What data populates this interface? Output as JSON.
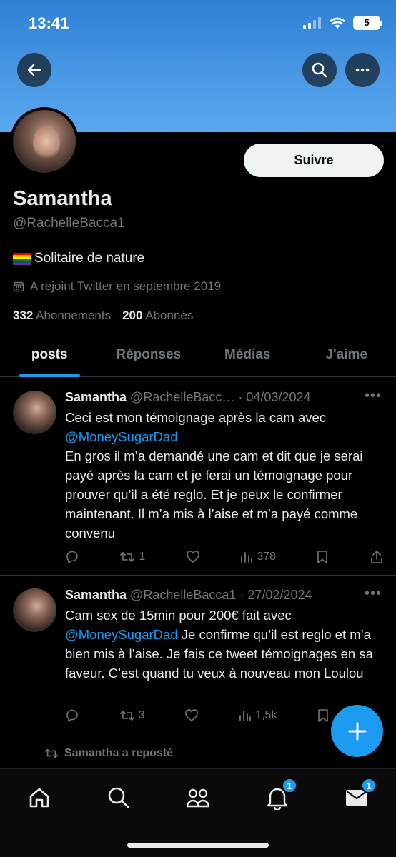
{
  "status": {
    "time": "13:41",
    "battery": "5"
  },
  "profile": {
    "name": "Samantha",
    "handle": "@RachelleBacca1",
    "bio": "Solitaire de nature",
    "joined": "A rejoint Twitter en septembre 2019",
    "following_count": "332",
    "following_label": "Abonnements",
    "followers_count": "200",
    "followers_label": "Abonnés",
    "follow_label": "Suivre"
  },
  "tabs": [
    "posts",
    "Réponses",
    "Médias",
    "J'aime"
  ],
  "tweets": [
    {
      "name": "Samantha",
      "handle": "@RachelleBacc…",
      "date": "· 04/03/2024",
      "line1": "Ceci est mon témoignage après la cam avec",
      "mention": "@MoneySugarDad",
      "rest": "En gros il m’a demandé une cam et dit que je serai payé après la cam et je ferai un témoignage pour prouver qu’il a été reglo. Et je peux le confirmer maintenant. Il m’a mis à l’aise et m’a payé comme convenu",
      "retweets": "1",
      "views": "378"
    },
    {
      "name": "Samantha",
      "handle": "@RachelleBacca1",
      "date": "· 27/02/2024",
      "line1": "Cam sex de 15min pour 200€ fait avec",
      "mention": "@MoneySugarDad",
      "rest": " Je confirme qu’il est reglo et m’a bien mis à l’aise. Je fais ce tweet témoignages en sa faveur. C’est quand tu veux à nouveau mon Loulou",
      "retweets": "3",
      "views": "1,5k"
    }
  ],
  "repost_label": "Samantha a reposté",
  "nav": {
    "notifications_badge": "1",
    "messages_badge": "1"
  }
}
